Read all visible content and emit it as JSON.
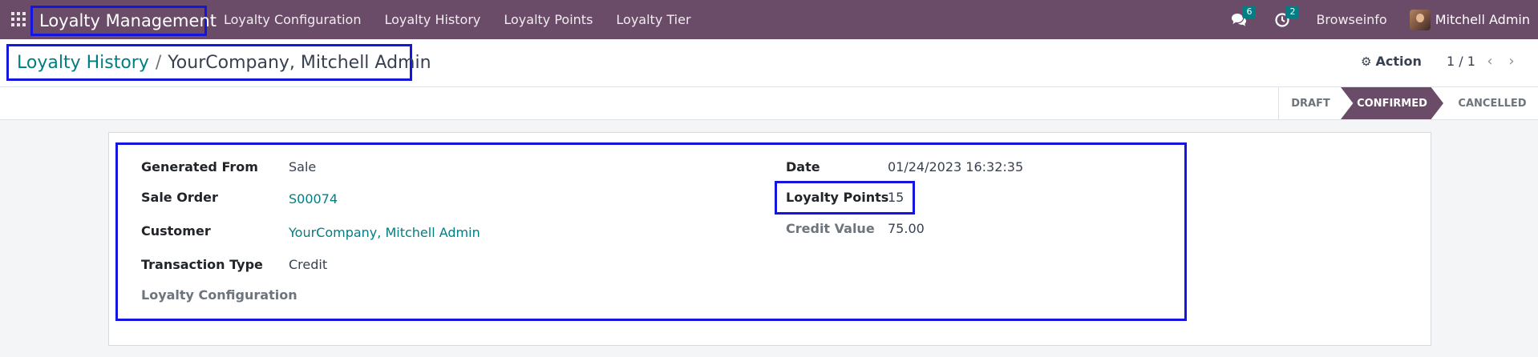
{
  "navbar": {
    "app_name": "Loyalty Management",
    "menu": [
      "Loyalty Configuration",
      "Loyalty History",
      "Loyalty Points",
      "Loyalty Tier"
    ],
    "messages_count": "6",
    "activities_count": "2",
    "company": "Browseinfo",
    "user": "Mitchell Admin",
    "color": "#6b4c68"
  },
  "breadcrumb": {
    "parent": "Loyalty History",
    "separator": "/",
    "current": "YourCompany, Mitchell Admin"
  },
  "control": {
    "action_label": "Action",
    "pager": "1 / 1"
  },
  "statusbar": {
    "stages": [
      "Draft",
      "Confirmed",
      "Cancelled"
    ],
    "active": "Confirmed"
  },
  "form": {
    "left": [
      {
        "label": "Generated From",
        "value": "Sale"
      },
      {
        "label": "Sale Order",
        "value": "S00074"
      },
      {
        "label": "Customer",
        "value": "YourCompany, Mitchell Admin"
      },
      {
        "label": "Transaction Type",
        "value": "Credit"
      },
      {
        "label": "Loyalty Configuration",
        "value": ""
      }
    ],
    "right": [
      {
        "label": "Date",
        "value": "01/24/2023 16:32:35"
      },
      {
        "label": "Loyalty Points",
        "value": "15"
      },
      {
        "label": "Credit Value",
        "value": "75.00"
      }
    ]
  }
}
